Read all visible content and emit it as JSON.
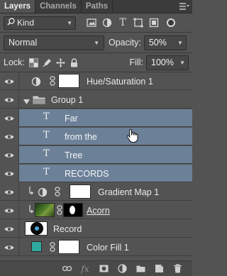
{
  "tabs": [
    {
      "label": "Layers"
    },
    {
      "label": "Channels"
    },
    {
      "label": "Paths"
    }
  ],
  "panel_menu_icon": "panel-menu-icon",
  "filter": {
    "kind_label": "Kind",
    "kind_icon": "search-icon",
    "filter_icons": [
      "pixel-filter-icon",
      "adjustment-filter-icon",
      "type-filter-icon",
      "shape-filter-icon",
      "smart-object-filter-icon"
    ],
    "type_glyph": "T"
  },
  "blend": {
    "mode": "Normal",
    "opacity_label": "Opacity:",
    "opacity_value": "50%"
  },
  "lock": {
    "label": "Lock:",
    "fill_label": "Fill:",
    "fill_value": "100%",
    "lock_icons": [
      "lock-transparent-icon",
      "lock-paint-icon",
      "lock-move-icon",
      "lock-all-icon"
    ]
  },
  "layers": [
    {
      "name": "Hue/Saturation 1",
      "kind": "adjustment",
      "selected": false
    },
    {
      "name": "Group 1",
      "kind": "group",
      "selected": false
    },
    {
      "name": "Far",
      "kind": "type",
      "selected": true
    },
    {
      "name": "from the",
      "kind": "type",
      "selected": true
    },
    {
      "name": "Tree",
      "kind": "type",
      "selected": true
    },
    {
      "name": "RECORDS",
      "kind": "type",
      "selected": true
    },
    {
      "name": "Gradient Map 1",
      "kind": "adjustment",
      "selected": false
    },
    {
      "name": "Acorn",
      "kind": "image",
      "selected": false
    },
    {
      "name": "Record",
      "kind": "image",
      "selected": false
    },
    {
      "name": "Color Fill 1",
      "kind": "fill",
      "selected": false
    }
  ],
  "type_glyph": "T",
  "colors": {
    "selection": "#6c8198",
    "panel": "#535353",
    "color_fill_swatch": "#2fa8a0"
  },
  "bottom_icons": [
    "link-layers-icon",
    "fx-icon",
    "add-mask-icon",
    "new-adjustment-icon",
    "new-group-icon",
    "new-layer-icon",
    "delete-layer-icon"
  ],
  "fx_glyph": "fx"
}
